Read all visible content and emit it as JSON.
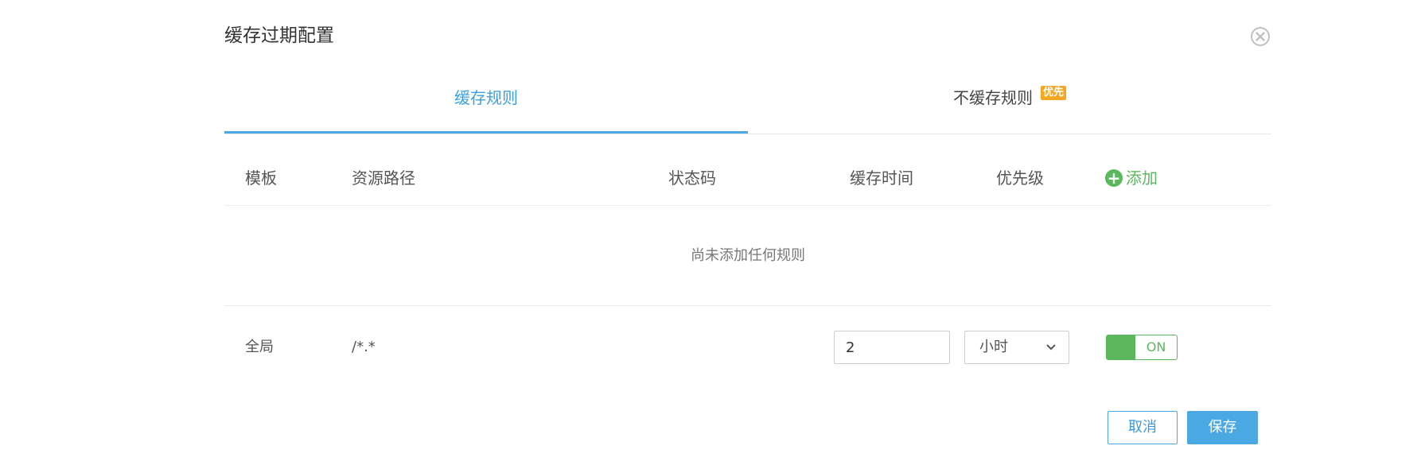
{
  "dialog": {
    "title": "缓存过期配置",
    "close_icon": "close-circle-icon"
  },
  "tabs": [
    {
      "label": "缓存规则",
      "active": true
    },
    {
      "label": "不缓存规则",
      "badge": "优先",
      "active": false
    }
  ],
  "table": {
    "headers": {
      "template": "模板",
      "path": "资源路径",
      "status_code": "状态码",
      "cache_time": "缓存时间",
      "priority": "优先级",
      "add": "添加"
    },
    "empty_text": "尚未添加任何规则"
  },
  "global_rule": {
    "template": "全局",
    "path": "/*.*",
    "time_value": "2",
    "time_unit": "小时",
    "toggle_label": "ON"
  },
  "actions": {
    "cancel": "取消",
    "save": "保存"
  },
  "colors": {
    "accent": "#4aa8e3",
    "success": "#5cb85c",
    "badge": "#f5a623"
  }
}
